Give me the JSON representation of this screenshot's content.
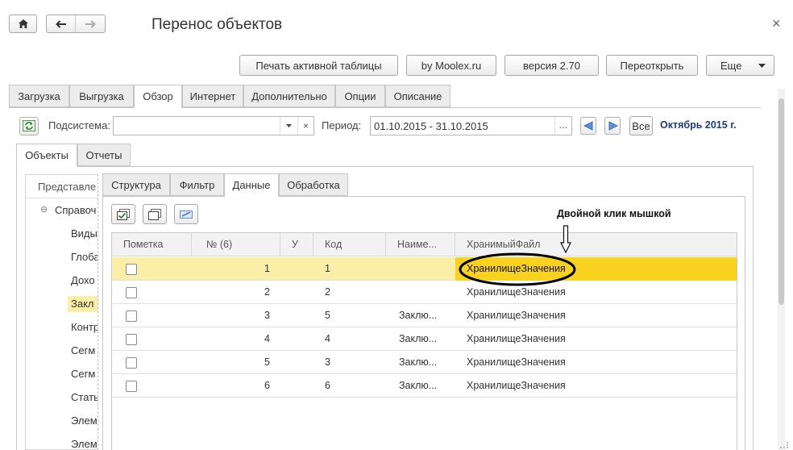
{
  "window": {
    "title": "Перенос объектов",
    "close_glyph": "×"
  },
  "toolbar": {
    "buttons": [
      "Печать активной таблицы",
      "by Moolex.ru",
      "версия 2.70",
      "Переоткрыть",
      "Еще"
    ]
  },
  "main_tabs": [
    "Загрузка",
    "Выгрузка",
    "Обзор",
    "Интернет",
    "Дополнительно",
    "Опции",
    "Описание"
  ],
  "filter": {
    "subsystem_label": "Подсистема:",
    "subsystem_value": "",
    "period_label": "Период:",
    "period_value": "01.10.2015 - 31.10.2015",
    "period_dots": "...",
    "all_label": "Все",
    "period_text": "Октябрь 2015 г.",
    "clear_glyph": "×"
  },
  "sub_tabs": [
    "Объекты",
    "Отчеты"
  ],
  "tree": {
    "header": "Представле",
    "root": "Справоч",
    "items": [
      "Виды",
      "Глоба",
      "Дохо",
      "Закл",
      "Контр",
      "Сегм",
      "Сегм",
      "Статы",
      "Элем",
      "Элем"
    ],
    "selected_index": 3
  },
  "inner_tabs": [
    "Структура",
    "Фильтр",
    "Данные",
    "Обработка"
  ],
  "annotation": "Двойной клик мышкой",
  "grid": {
    "columns": [
      "Пометка",
      "№ (6)",
      "У",
      "Код",
      "Наиме...",
      "ХранимыйФайл"
    ],
    "rows": [
      {
        "n": "1",
        "u": "",
        "code": "1",
        "name": "",
        "file": "ХранилищеЗначения"
      },
      {
        "n": "2",
        "u": "",
        "code": "2",
        "name": "",
        "file": "ХранилищеЗначения"
      },
      {
        "n": "3",
        "u": "",
        "code": "5",
        "name": "Заклю...",
        "file": "ХранилищеЗначения"
      },
      {
        "n": "4",
        "u": "",
        "code": "4",
        "name": "Заклю...",
        "file": "ХранилищеЗначения"
      },
      {
        "n": "5",
        "u": "",
        "code": "3",
        "name": "Заклю...",
        "file": "ХранилищеЗначения"
      },
      {
        "n": "6",
        "u": "",
        "code": "6",
        "name": "Заклю...",
        "file": "ХранилищеЗначения"
      }
    ],
    "selected_row": 0
  },
  "colors": {
    "selected_row": "#fbeea7",
    "selected_cell": "#f8d21e",
    "tree_selected": "#fbeea7",
    "period_text": "#1f3a7a"
  }
}
